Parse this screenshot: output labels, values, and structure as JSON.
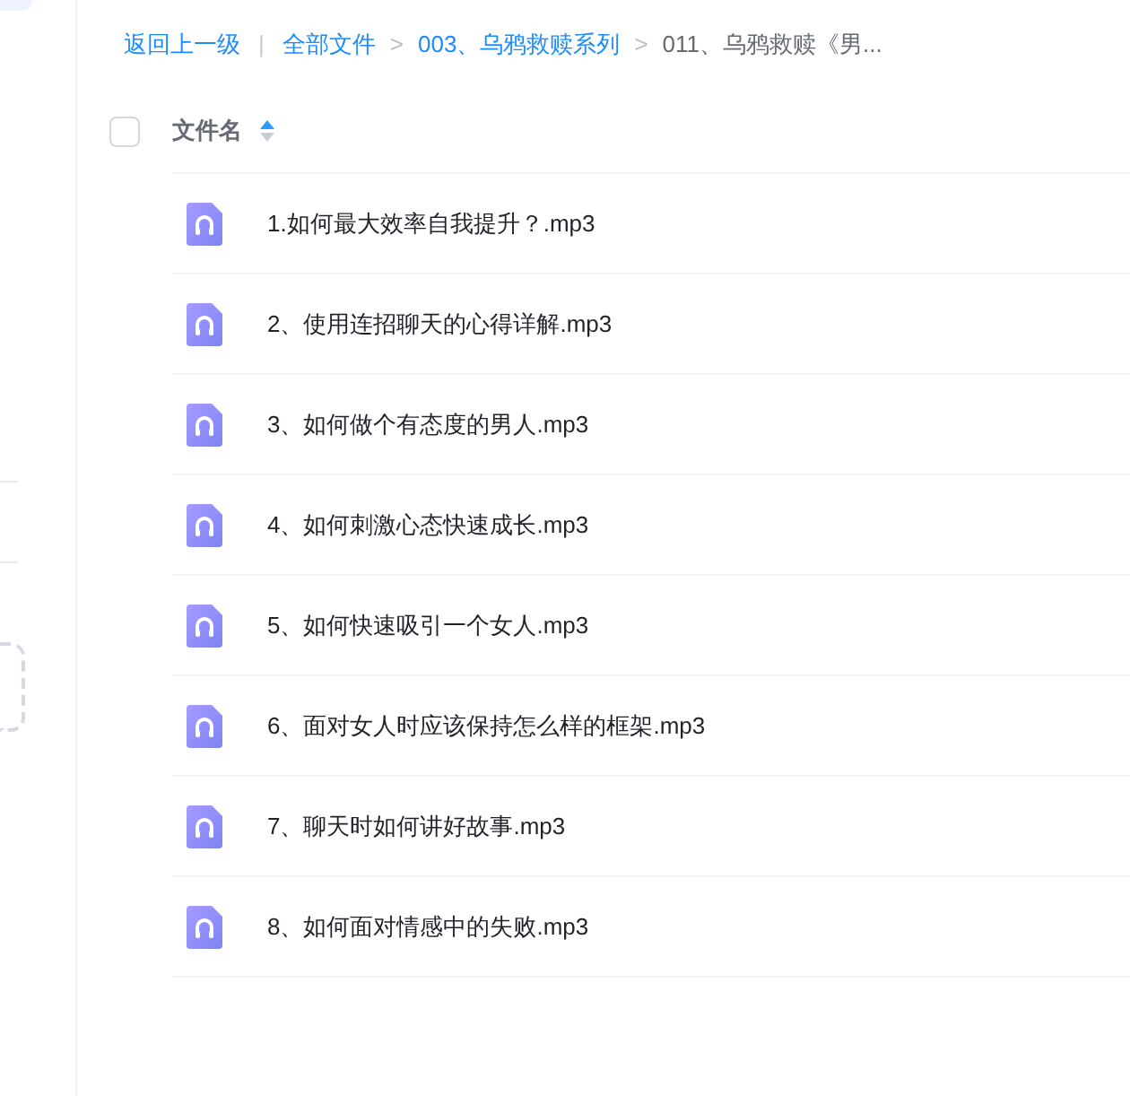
{
  "breadcrumb": {
    "back": "返回上一级",
    "separator": "|",
    "items": [
      {
        "label": "全部文件",
        "current": false
      },
      {
        "label": "003、乌鸦救赎系列",
        "current": false
      },
      {
        "label": "011、乌鸦救赎《男...",
        "current": true
      }
    ],
    "arrow": ">"
  },
  "table": {
    "header": {
      "checked": false,
      "column": "文件名"
    },
    "rows": [
      {
        "name": "1.如何最大效率自我提升？.mp3"
      },
      {
        "name": "2、使用连招聊天的心得详解.mp3"
      },
      {
        "name": "3、如何做个有态度的男人.mp3"
      },
      {
        "name": "4、如何刺激心态快速成长.mp3"
      },
      {
        "name": "5、如何快速吸引一个女人.mp3"
      },
      {
        "name": "6、面对女人时应该保持怎么样的框架.mp3"
      },
      {
        "name": "7、聊天时如何讲好故事.mp3"
      },
      {
        "name": "8、如何面对情感中的失败.mp3"
      }
    ]
  }
}
